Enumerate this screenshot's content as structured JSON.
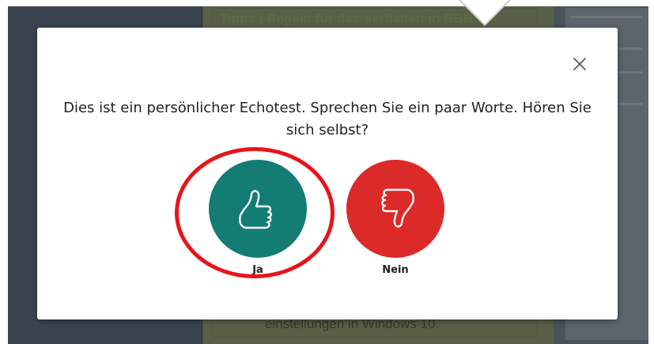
{
  "background": {
    "slide_title": "Tipps / Regeln für das Verhalten in BBB",
    "slide_footer": "einstellungen in Windows 10."
  },
  "modal": {
    "message": "Dies ist ein persönlicher Echotest. Sprechen Sie ein paar Worte. Hören Sie sich selbst?",
    "close_icon": "close-icon",
    "yes": {
      "label": "Ja",
      "icon": "thumbs-up-icon",
      "color": "#137c73"
    },
    "no": {
      "label": "Nein",
      "icon": "thumbs-down-icon",
      "color": "#dc2a28"
    }
  },
  "colors": {
    "overlay": "#3c4550",
    "highlight": "#e8141c"
  }
}
